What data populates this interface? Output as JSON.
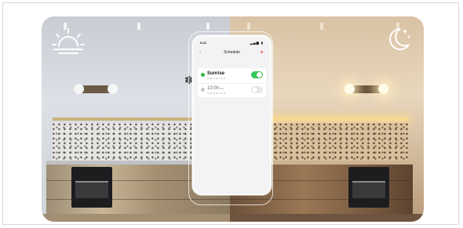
{
  "scene": {
    "left_panel": {
      "icon": "sunrise-icon"
    },
    "right_panel": {
      "icon": "moon-stars-icon"
    }
  },
  "phone": {
    "status": {
      "time": "9:41",
      "signal": "signal-wifi-battery-icons"
    },
    "nav": {
      "back_icon": "chevron-left-icon",
      "title": "Schedule",
      "add_icon": "plus-icon"
    },
    "schedules": [
      {
        "title": "Sunrise",
        "subtitle": "S M T W T F S",
        "enabled": true,
        "icon": "sunrise-small-icon"
      },
      {
        "title": "10:00",
        "ampm": "PM",
        "subtitle": "S M T W T F S",
        "enabled": false,
        "icon": "clock-icon"
      }
    ]
  },
  "colors": {
    "toggle_on": "#34c759",
    "accent_add": "#e21e26"
  }
}
